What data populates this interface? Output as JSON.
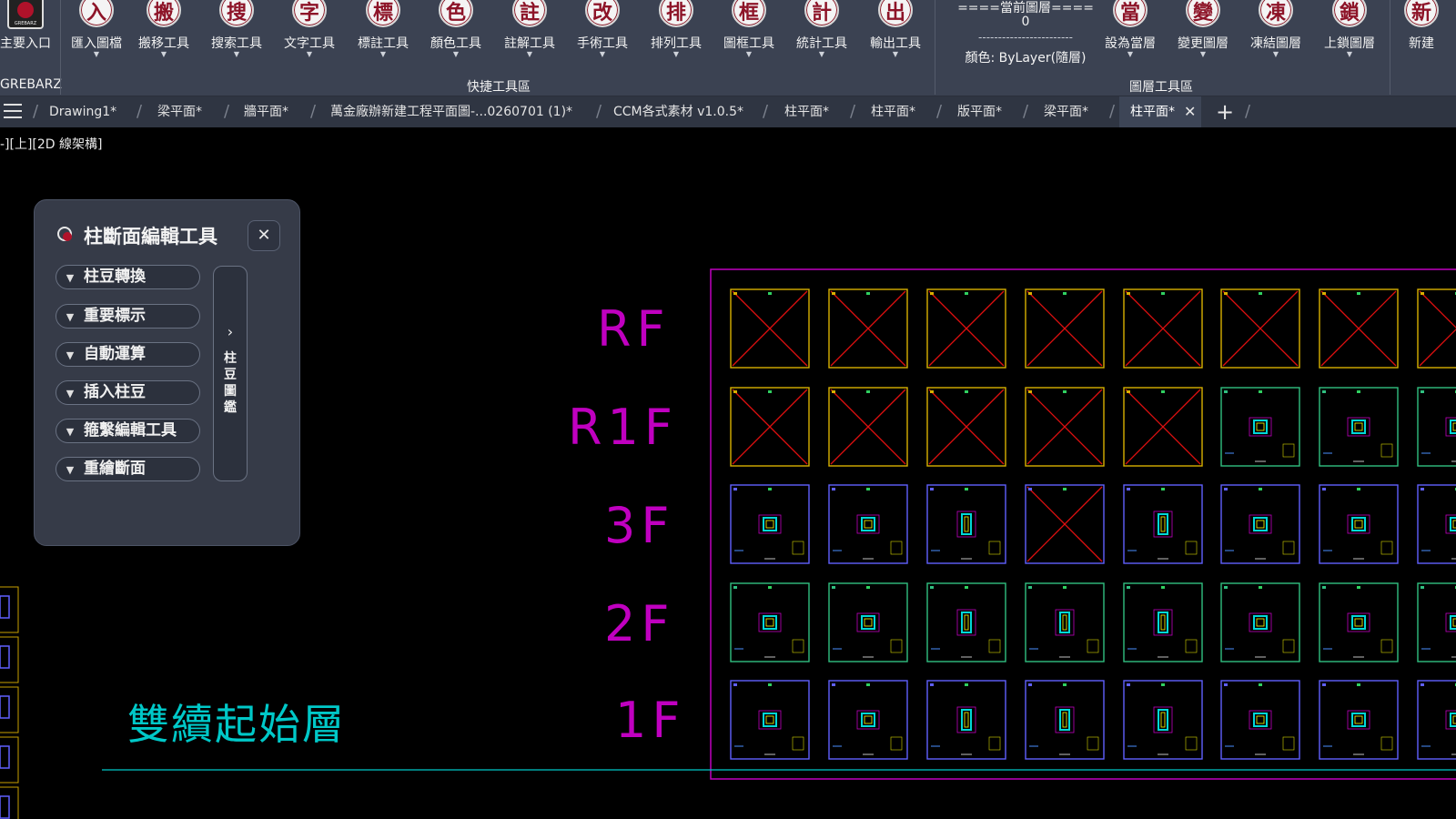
{
  "ribbon": {
    "tools": [
      {
        "label": "主要入口",
        "icon": "logo-icon",
        "glyph": ""
      },
      {
        "label": "匯入圖檔",
        "icon": "import-icon",
        "glyph": "入"
      },
      {
        "label": "搬移工具",
        "icon": "move-icon",
        "glyph": "搬"
      },
      {
        "label": "搜索工具",
        "icon": "search-icon",
        "glyph": "搜"
      },
      {
        "label": "文字工具",
        "icon": "text-icon",
        "glyph": "字"
      },
      {
        "label": "標註工具",
        "icon": "dimension-icon",
        "glyph": "標"
      },
      {
        "label": "顏色工具",
        "icon": "color-icon",
        "glyph": "色"
      },
      {
        "label": "註解工具",
        "icon": "annotation-icon",
        "glyph": "註"
      },
      {
        "label": "手術工具",
        "icon": "edit-icon",
        "glyph": "改"
      },
      {
        "label": "排列工具",
        "icon": "arrange-icon",
        "glyph": "排"
      },
      {
        "label": "圖框工具",
        "icon": "frame-icon",
        "glyph": "框"
      },
      {
        "label": "統計工具",
        "icon": "statistics-icon",
        "glyph": "計"
      },
      {
        "label": "輸出工具",
        "icon": "export-icon",
        "glyph": "出"
      }
    ],
    "layer_tools": [
      {
        "label": "設為當層",
        "icon": "set-current-layer-icon",
        "glyph": "當"
      },
      {
        "label": "變更圖層",
        "icon": "change-layer-icon",
        "glyph": "變"
      },
      {
        "label": "凍結圖層",
        "icon": "freeze-layer-icon",
        "glyph": "凍"
      },
      {
        "label": "上鎖圖層",
        "icon": "lock-layer-icon",
        "glyph": "鎖"
      },
      {
        "label": "新建",
        "icon": "new-layer-icon",
        "glyph": "新"
      }
    ],
    "groups": {
      "brand": "GREBARZ",
      "quick": "快捷工具區",
      "layer": "圖層工具區"
    },
    "current_layer": {
      "header": "====當前圖層====",
      "name": "0",
      "divider": "------------------------",
      "color": "顏色: ByLayer(隨層)"
    },
    "logo_text": "GREBARZ"
  },
  "tabs": {
    "items": [
      {
        "label": "Drawing1*"
      },
      {
        "label": "梁平面*"
      },
      {
        "label": "牆平面*"
      },
      {
        "label": "萬金廠辦新建工程平面圖-...0260701 (1)*"
      },
      {
        "label": "CCM各式素材 v1.0.5*"
      },
      {
        "label": "柱平面*"
      },
      {
        "label": "柱平面*"
      },
      {
        "label": "版平面*"
      },
      {
        "label": "梁平面*"
      },
      {
        "label": "柱平面*"
      }
    ],
    "active_index": 9,
    "close_glyph": "✕",
    "add_glyph": "+"
  },
  "viewport": {
    "label": "-][上][2D 線架構]"
  },
  "palette": {
    "title": "柱斷面編輯工具",
    "close_glyph": "✕",
    "buttons": [
      {
        "label": "柱豆轉換"
      },
      {
        "label": "重要標示"
      },
      {
        "label": "自動運算"
      },
      {
        "label": "插入柱豆"
      },
      {
        "label": "箍繫編輯工具"
      },
      {
        "label": "重繪斷面"
      }
    ],
    "side_arrow": "›",
    "side_label": "柱豆圖鑑"
  },
  "drawing": {
    "floors": [
      "RF",
      "R1F",
      "3F",
      "2F",
      "1F"
    ],
    "start_layer_text": "雙續起始層",
    "colors": {
      "floor_text": "#c000c0",
      "start_text": "#00c8c8",
      "frame": "#c000c0",
      "cross": "#e01010",
      "box_yellow": "#d8b000",
      "box_blue": "#6060ff",
      "box_green": "#30c080"
    },
    "grid": [
      [
        "x-yellow",
        "x-yellow",
        "x-yellow",
        "x-yellow",
        "x-yellow",
        "x-yellow",
        "x-yellow"
      ],
      [
        "x-yellow",
        "x-yellow",
        "x-yellow",
        "x-yellow",
        "x-yellow",
        "col-green",
        "col-green"
      ],
      [
        "col-blue",
        "col-blue",
        "col-blue",
        "x-blue",
        "col-blue",
        "col-blue",
        "col-blue"
      ],
      [
        "col-green",
        "col-green",
        "col-green",
        "col-green",
        "col-green",
        "col-green",
        "col-green"
      ],
      [
        "col-blue",
        "col-blue",
        "col-blue",
        "col-blue",
        "col-blue",
        "col-blue",
        "col-blue"
      ]
    ]
  }
}
